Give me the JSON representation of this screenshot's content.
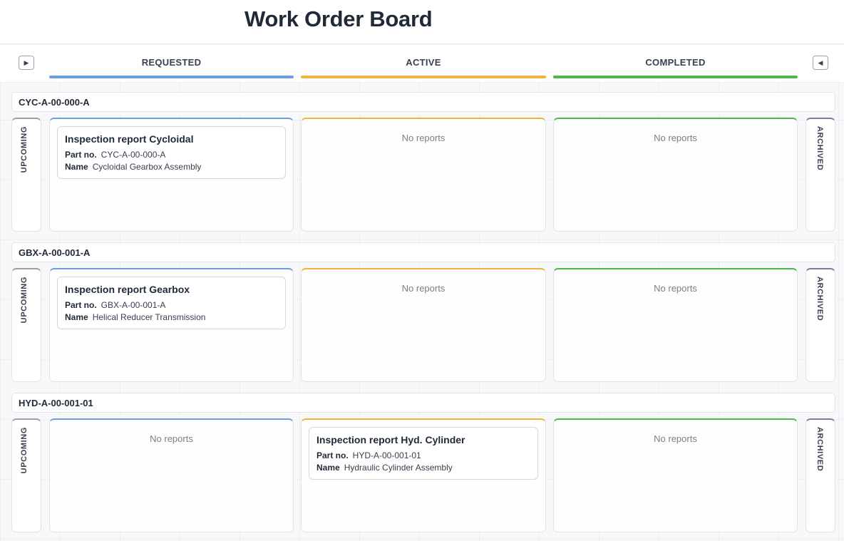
{
  "page": {
    "title": "Work Order Board"
  },
  "columns": {
    "requested": {
      "label": "REQUESTED",
      "color": "#6e9de0"
    },
    "active": {
      "label": "ACTIVE",
      "color": "#f0b43c"
    },
    "completed": {
      "label": "COMPLETED",
      "color": "#4db84d"
    }
  },
  "side_columns": {
    "upcoming": {
      "label": "UPCOMING",
      "color": "#9aa0a8"
    },
    "archived": {
      "label": "ARCHIVED",
      "color": "#7d7a9e"
    }
  },
  "controls": {
    "expand_left_icon": "▶",
    "expand_right_icon": "◀"
  },
  "field_labels": {
    "part_no": "Part no.",
    "name": "Name"
  },
  "empty_text": "No reports",
  "groups": [
    {
      "id": "CYC-A-00-000-A",
      "requested": {
        "title": "Inspection report Cycloidal",
        "part_no": "CYC-A-00-000-A",
        "name": "Cycloidal Gearbox Assembly"
      },
      "active": null,
      "completed": null
    },
    {
      "id": "GBX-A-00-001-A",
      "requested": {
        "title": "Inspection report Gearbox",
        "part_no": "GBX-A-00-001-A",
        "name": "Helical Reducer Transmission"
      },
      "active": null,
      "completed": null
    },
    {
      "id": "HYD-A-00-001-01",
      "requested": null,
      "active": {
        "title": "Inspection report Hyd. Cylinder",
        "part_no": "HYD-A-00-001-01",
        "name": "Hydraulic Cylinder Assembly"
      },
      "completed": null
    }
  ]
}
